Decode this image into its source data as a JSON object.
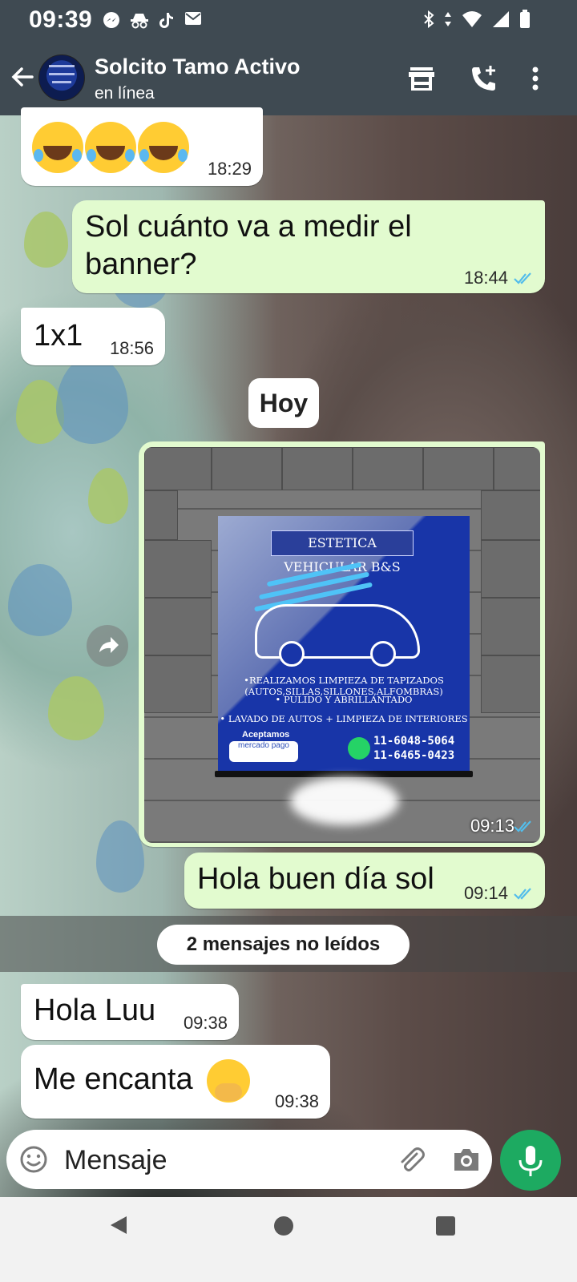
{
  "status_bar": {
    "time": "09:39",
    "notification_icons": [
      "messenger-icon",
      "incognito-icon",
      "tiktok-icon",
      "mail-icon"
    ],
    "system_icons": [
      "bluetooth-icon",
      "data-arrows-icon",
      "wifi-icon",
      "signal-icon",
      "battery-icon"
    ]
  },
  "header": {
    "contact_name": "Solcito Tamo Activo",
    "contact_status": "en línea",
    "actions": [
      "store-icon",
      "add-call-icon",
      "more-vert-icon"
    ],
    "bg_color": "#3f4a52"
  },
  "messages": [
    {
      "direction": "in",
      "emojis": [
        "rolling-laughing",
        "rolling-laughing",
        "rolling-laughing"
      ],
      "time": "18:29"
    },
    {
      "direction": "out",
      "text": "Sol cuánto va a medir el banner?",
      "time": "18:44",
      "status": "read"
    },
    {
      "direction": "in",
      "text": "1x1",
      "time": "18:56"
    }
  ],
  "day_divider": "Hoy",
  "image_message": {
    "direction": "out",
    "time": "09:13",
    "status": "read",
    "banner": {
      "title": "ESTETICA VEHICULAR B&S",
      "line1": "•REALIZAMOS LIMPIEZA DE TAPIZADOS (AUTOS,SILLAS,SILLONES,ALFOMBRAS)",
      "line2": "• PULIDO Y ABRILLANTADO",
      "line3": "• LAVADO DE AUTOS + LIMPIEZA DE INTERIORES",
      "accept": "Aceptamos",
      "payment_logo": "mercado pago",
      "phone1": "11-6048-5064",
      "phone2": "11-6465-0423"
    }
  },
  "messages_after": [
    {
      "direction": "out",
      "text": "Hola buen día sol",
      "time": "09:14",
      "status": "read"
    }
  ],
  "unread_label": "2 mensajes no leídos",
  "messages_unread": [
    {
      "direction": "in",
      "text": "Hola Luu",
      "time": "09:38"
    },
    {
      "direction": "in",
      "text": "Me encanta",
      "emoji": "hand-over-mouth",
      "time": "09:38"
    }
  ],
  "composer": {
    "placeholder": "Mensaje",
    "value": "",
    "icons": [
      "emoji-icon",
      "attach-icon",
      "camera-icon",
      "mic-icon"
    ],
    "mic_color": "#1daa61"
  },
  "colors": {
    "outgoing_bubble": "#e2fbcf",
    "incoming_bubble": "#ffffff",
    "read_ticks": "#53bdeb"
  }
}
